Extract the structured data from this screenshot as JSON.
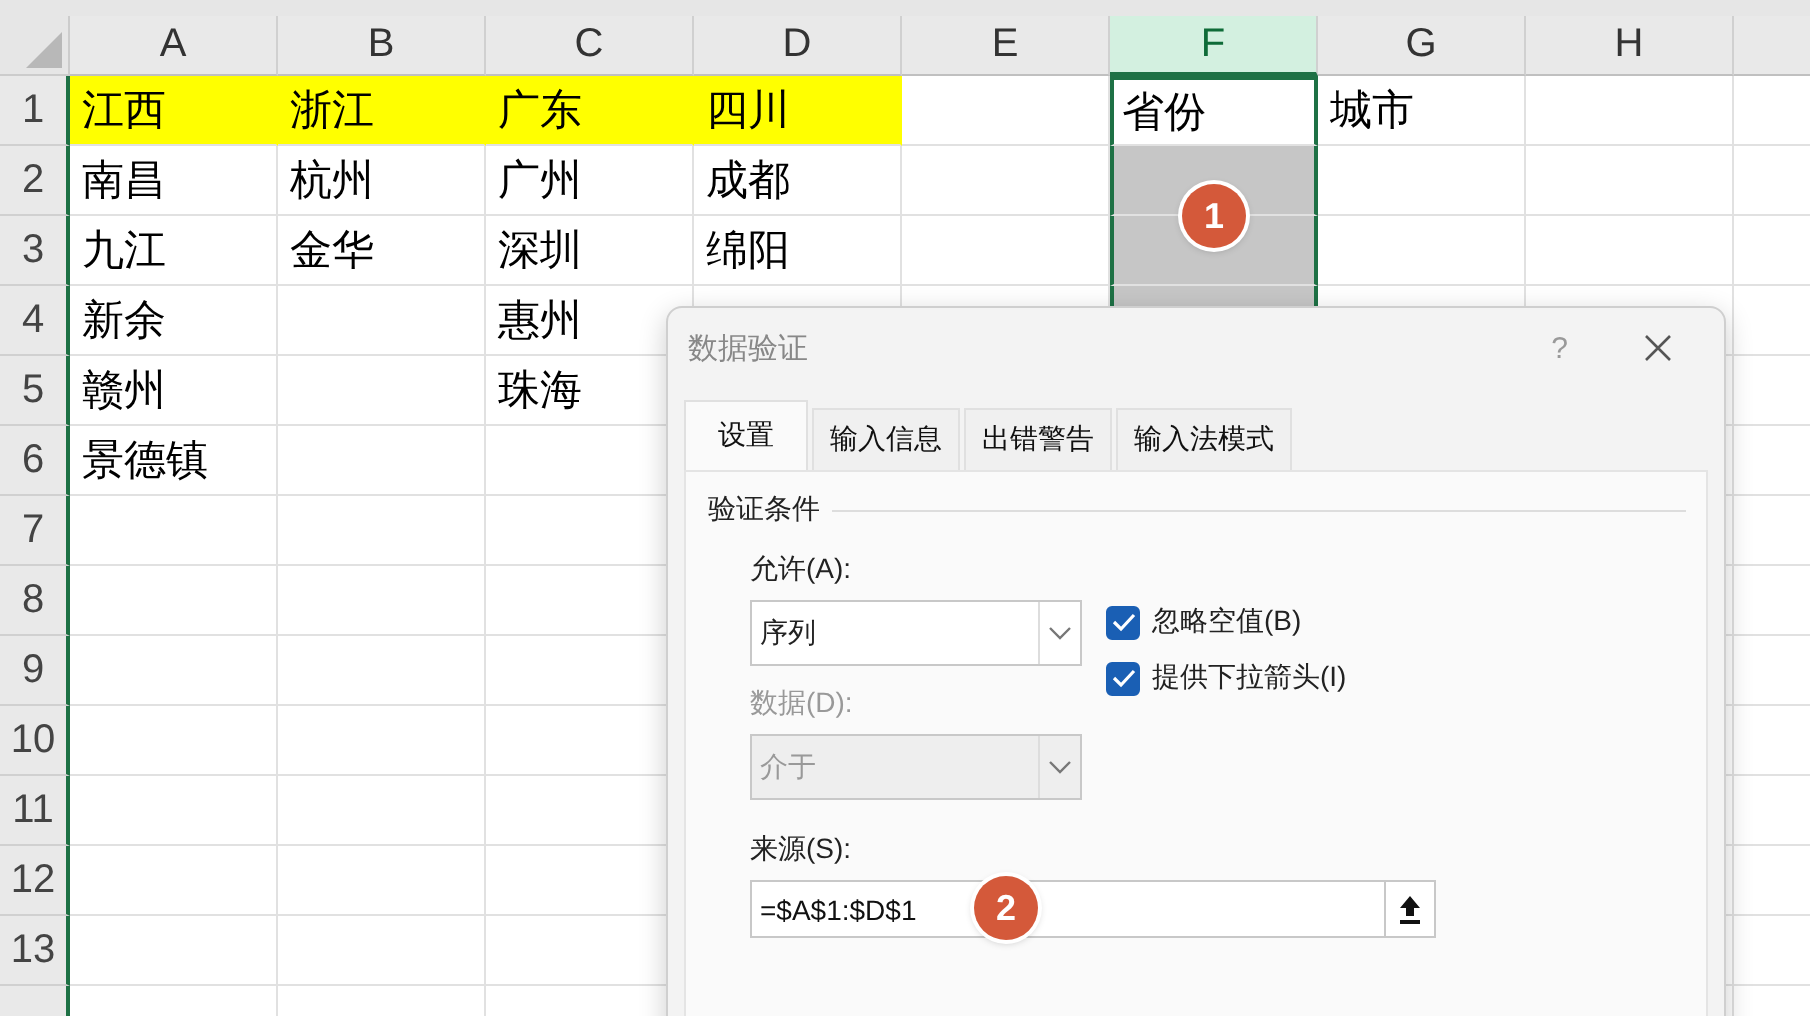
{
  "sheet": {
    "columns": [
      {
        "label": "A",
        "selected": false
      },
      {
        "label": "B",
        "selected": false
      },
      {
        "label": "C",
        "selected": false
      },
      {
        "label": "D",
        "selected": false
      },
      {
        "label": "E",
        "selected": false
      },
      {
        "label": "F",
        "selected": true
      },
      {
        "label": "G",
        "selected": false
      },
      {
        "label": "H",
        "selected": false
      }
    ],
    "rows": [
      {
        "number": "1",
        "cells": [
          {
            "text": "江西",
            "highlighted": true,
            "selected": false
          },
          {
            "text": "浙江",
            "highlighted": true,
            "selected": false
          },
          {
            "text": "广东",
            "highlighted": true,
            "selected": false
          },
          {
            "text": "四川",
            "highlighted": true,
            "selected": false
          },
          {
            "highlighted": false,
            "selected": false
          },
          {
            "text": "省份",
            "highlighted": false,
            "selected": true,
            "active": true
          },
          {
            "text": "城市",
            "highlighted": false,
            "selected": false
          }
        ]
      },
      {
        "number": "2",
        "cells": [
          {
            "text": "南昌",
            "highlighted": false,
            "selected": false
          },
          {
            "text": "杭州",
            "highlighted": false,
            "selected": false
          },
          {
            "text": "广州",
            "highlighted": false,
            "selected": false
          },
          {
            "text": "成都",
            "highlighted": false,
            "selected": false
          },
          {
            "highlighted": false,
            "selected": false
          },
          {
            "highlighted": false,
            "selected": true,
            "badge": "1"
          }
        ]
      },
      {
        "number": "3",
        "cells": [
          {
            "text": "九江",
            "highlighted": false,
            "selected": false
          },
          {
            "text": "金华",
            "highlighted": false,
            "selected": false
          },
          {
            "text": "深圳",
            "highlighted": false,
            "selected": false
          },
          {
            "text": "绵阳",
            "highlighted": false,
            "selected": false
          },
          {
            "highlighted": false,
            "selected": false
          },
          {
            "highlighted": false,
            "selected": true
          }
        ]
      },
      {
        "number": "4",
        "cells": [
          {
            "text": "新余",
            "highlighted": false,
            "selected": false
          },
          {
            "highlighted": false,
            "selected": false
          },
          {
            "text": "惠州",
            "highlighted": false,
            "selected": false
          },
          {
            "highlighted": false,
            "selected": false
          },
          {
            "highlighted": false,
            "selected": false
          },
          {
            "highlighted": false,
            "selected": true
          }
        ]
      },
      {
        "number": "5",
        "cells": [
          {
            "text": "赣州",
            "highlighted": false,
            "selected": false
          },
          {
            "highlighted": false,
            "selected": false
          },
          {
            "text": "珠海",
            "highlighted": false,
            "selected": false
          }
        ]
      },
      {
        "number": "6",
        "cells": [
          {
            "text": "景德镇",
            "highlighted": false,
            "selected": false
          }
        ]
      },
      {
        "number": "7",
        "cells": []
      },
      {
        "number": "8",
        "cells": []
      },
      {
        "number": "9",
        "cells": []
      },
      {
        "number": "10",
        "cells": []
      },
      {
        "number": "11",
        "cells": []
      },
      {
        "number": "12",
        "cells": []
      },
      {
        "number": "13",
        "cells": []
      }
    ]
  },
  "dialog": {
    "title": "数据验证",
    "help": "?",
    "tabs": [
      {
        "label": "设置",
        "selected": true
      },
      {
        "label": "输入信息",
        "selected": false
      },
      {
        "label": "出错警告",
        "selected": false
      },
      {
        "label": "输入法模式",
        "selected": false
      }
    ],
    "group_title": "验证条件",
    "allow": {
      "label": "允许(A):",
      "value": "序列",
      "disabled": false
    },
    "data": {
      "label": "数据(D):",
      "value": "介于",
      "disabled": true
    },
    "checkboxes": [
      {
        "label": "忽略空值(B)",
        "checked": true
      },
      {
        "label": "提供下拉箭头(I)",
        "checked": true
      }
    ],
    "source": {
      "label": "来源(S):",
      "value": "=$A$1:$D$1",
      "badge": "2"
    }
  }
}
